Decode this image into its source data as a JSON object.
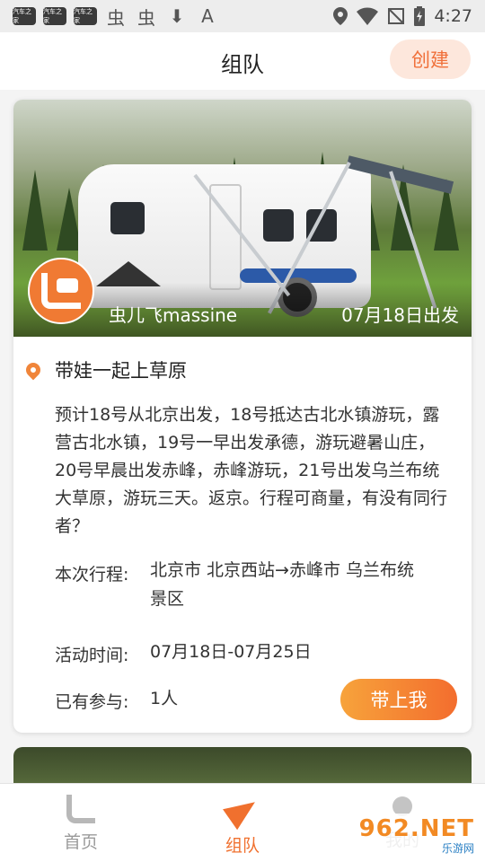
{
  "status_bar": {
    "time": "4:27",
    "app_icons": [
      "汽车之家",
      "汽车之家",
      "汽车之家"
    ],
    "left_glyphs": [
      "虫",
      "虫",
      "⬇",
      "A"
    ],
    "right_icons": [
      "location-icon",
      "wifi-icon",
      "no-sim-icon",
      "battery-icon"
    ]
  },
  "header": {
    "title": "组队",
    "create_label": "创建"
  },
  "trip_card": {
    "user_name": "虫儿飞massine",
    "depart_date": "07月18日出发",
    "title": "带娃一起上草原",
    "description": "预计18号从北京出发，18号抵达古北水镇游玩，露营古北水镇，19号一早出发承德，游玩避暑山庄，20号早晨出发赤峰，赤峰游玩，21号出发乌兰布统大草原，游玩三天。返京。行程可商量，有没有同行者？",
    "route_label": "本次行程:",
    "route_value": "北京市 北京西站→赤峰市 乌兰布统景区",
    "time_label": "活动时间:",
    "time_value": "07月18日-07月25日",
    "participants_label": "已有参与:",
    "participants_value": "1人",
    "join_label": "带上我"
  },
  "tab_bar": {
    "tabs": [
      {
        "label": "首页",
        "icon": "home-icon",
        "active": false
      },
      {
        "label": "组队",
        "icon": "paper-plane-icon",
        "active": true
      },
      {
        "label": "我的",
        "icon": "person-icon",
        "active": false
      }
    ]
  },
  "watermark": {
    "main": "962.NET",
    "sub": "乐游网"
  },
  "colors": {
    "accent": "#f0702e",
    "create_bg": "#fde7dc",
    "inactive_tab": "#9a9a9a"
  }
}
